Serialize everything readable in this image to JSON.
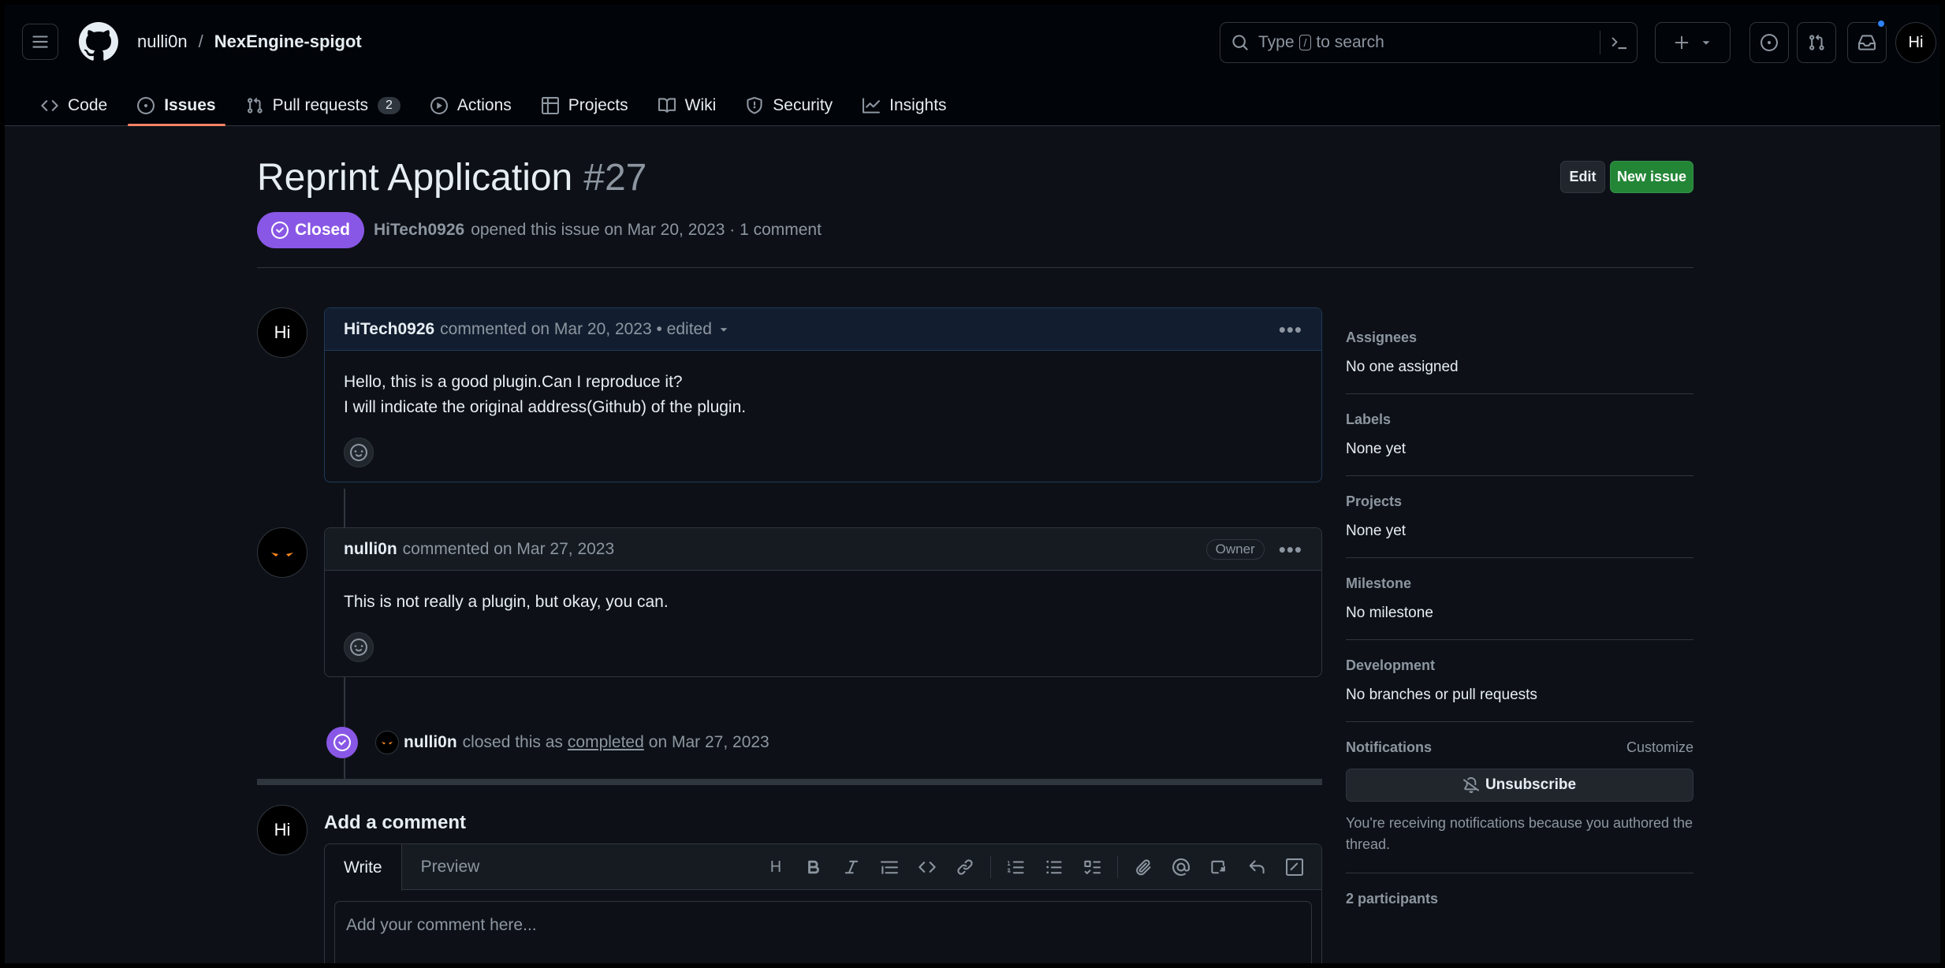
{
  "header": {
    "owner": "nulli0n",
    "separator": "/",
    "repo": "NexEngine-spigot",
    "search": {
      "before": "Type",
      "key": "/",
      "after": "to search"
    },
    "user_avatar": "Hi"
  },
  "tabs": [
    {
      "label": "Code",
      "icon": "code-icon"
    },
    {
      "label": "Issues",
      "icon": "issue-opened-icon",
      "selected": true
    },
    {
      "label": "Pull requests",
      "icon": "git-pull-request-icon",
      "counter": "2"
    },
    {
      "label": "Actions",
      "icon": "play-icon"
    },
    {
      "label": "Projects",
      "icon": "table-icon"
    },
    {
      "label": "Wiki",
      "icon": "book-icon"
    },
    {
      "label": "Security",
      "icon": "shield-icon"
    },
    {
      "label": "Insights",
      "icon": "graph-icon"
    }
  ],
  "issue": {
    "title": "Reprint Application",
    "number": "#27",
    "state": "Closed",
    "author": "HiTech0926",
    "meta": "opened this issue on Mar 20, 2023 · 1 comment",
    "edit_label": "Edit",
    "new_issue_label": "New issue"
  },
  "comments": [
    {
      "avatar": "Hi",
      "author": "HiTech0926",
      "meta": "commented on Mar 20, 2023 • edited",
      "lines": [
        "Hello, this is a good plugin.Can I reproduce it?",
        "I will indicate the original address(Github) of the plugin."
      ]
    },
    {
      "author": "nulli0n",
      "meta": "commented on Mar 27, 2023",
      "badge": "Owner",
      "lines": [
        "This is not really a plugin, but okay, you can."
      ]
    }
  ],
  "event": {
    "actor": "nulli0n",
    "text_before": "closed this as",
    "link": "completed",
    "text_after": "on Mar 27, 2023"
  },
  "add_comment": {
    "title": "Add a comment",
    "avatar": "Hi",
    "tab_write": "Write",
    "tab_preview": "Preview",
    "placeholder": "Add your comment here...",
    "heading_tool": "H"
  },
  "sidebar": {
    "assignees": {
      "label": "Assignees",
      "value": "No one assigned"
    },
    "labels": {
      "label": "Labels",
      "value": "None yet"
    },
    "projects": {
      "label": "Projects",
      "value": "None yet"
    },
    "milestone": {
      "label": "Milestone",
      "value": "No milestone"
    },
    "development": {
      "label": "Development",
      "value": "No branches or pull requests"
    },
    "notifications": {
      "label": "Notifications",
      "customize": "Customize",
      "button": "Unsubscribe",
      "note": "You're receiving notifications because you authored the thread."
    },
    "participants": "2 participants"
  },
  "colors": {
    "closed_purple": "#8957e5",
    "selected_tab_underline": "#f78166",
    "new_issue_green": "#238636",
    "notification_dot": "#2f81f7"
  }
}
